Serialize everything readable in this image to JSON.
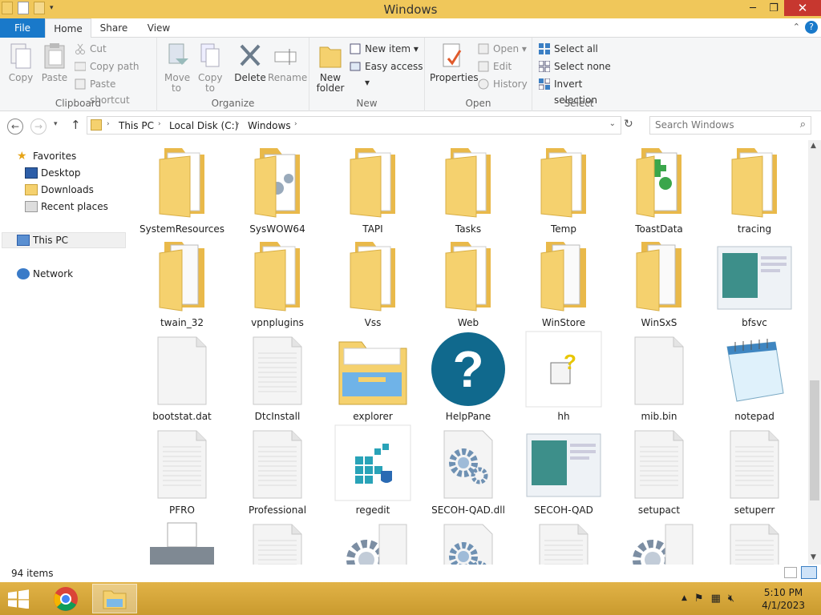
{
  "window": {
    "title": "Windows",
    "minimize": "─",
    "restore": "❐",
    "close": "✕"
  },
  "ribbon_tabs": {
    "file": "File",
    "home": "Home",
    "share": "Share",
    "view": "View",
    "help": "?",
    "collapse": "⌃"
  },
  "clipboard": {
    "copy": "Copy",
    "paste": "Paste",
    "cut": "Cut",
    "copy_path": "Copy path",
    "paste_shortcut": "Paste shortcut",
    "label": "Clipboard"
  },
  "organize": {
    "move_to": "Move to",
    "copy_to": "Copy to",
    "delete": "Delete",
    "rename": "Rename",
    "label": "Organize"
  },
  "new": {
    "new_folder": "New folder",
    "new_item": "New item ▾",
    "easy_access": "Easy access ▾",
    "label": "New"
  },
  "open": {
    "properties": "Properties",
    "open": "Open ▾",
    "edit": "Edit",
    "history": "History",
    "label": "Open"
  },
  "select": {
    "select_all": "Select all",
    "select_none": "Select none",
    "invert": "Invert selection",
    "label": "Select"
  },
  "address": {
    "crumbs": [
      "This PC",
      "Local Disk (C:)",
      "Windows"
    ],
    "search_placeholder": "Search Windows"
  },
  "nav": {
    "favorites": "Favorites",
    "desktop": "Desktop",
    "downloads": "Downloads",
    "recent": "Recent places",
    "this_pc": "This PC",
    "network": "Network"
  },
  "files": [
    {
      "name": "SystemResources",
      "icon": "folder"
    },
    {
      "name": "SysWOW64",
      "icon": "folder-docs"
    },
    {
      "name": "TAPI",
      "icon": "folder"
    },
    {
      "name": "Tasks",
      "icon": "folder"
    },
    {
      "name": "Temp",
      "icon": "folder"
    },
    {
      "name": "ToastData",
      "icon": "folder-green"
    },
    {
      "name": "tracing",
      "icon": "folder"
    },
    {
      "name": "twain_32",
      "icon": "folder-doc"
    },
    {
      "name": "vpnplugins",
      "icon": "folder"
    },
    {
      "name": "Vss",
      "icon": "folder"
    },
    {
      "name": "Web",
      "icon": "folder"
    },
    {
      "name": "WinStore",
      "icon": "folder-doc"
    },
    {
      "name": "WinSxS",
      "icon": "folder-doc"
    },
    {
      "name": "bfsvc",
      "icon": "app-window"
    },
    {
      "name": "bootstat.dat",
      "icon": "file"
    },
    {
      "name": "DtcInstall",
      "icon": "file-lines"
    },
    {
      "name": "explorer",
      "icon": "explorer"
    },
    {
      "name": "HelpPane",
      "icon": "help"
    },
    {
      "name": "hh",
      "icon": "hh"
    },
    {
      "name": "mib.bin",
      "icon": "file"
    },
    {
      "name": "notepad",
      "icon": "notepad"
    },
    {
      "name": "PFRO",
      "icon": "file-lines"
    },
    {
      "name": "Professional",
      "icon": "file-lines"
    },
    {
      "name": "regedit",
      "icon": "regedit"
    },
    {
      "name": "SECOH-QAD.dll",
      "icon": "gear-file"
    },
    {
      "name": "SECOH-QAD",
      "icon": "app-window"
    },
    {
      "name": "setupact",
      "icon": "file-lines"
    },
    {
      "name": "setuperr",
      "icon": "file-lines"
    },
    {
      "name": "",
      "icon": "printer"
    },
    {
      "name": "",
      "icon": "file-lines"
    },
    {
      "name": "",
      "icon": "gear"
    },
    {
      "name": "",
      "icon": "gear-file"
    },
    {
      "name": "",
      "icon": "file-lines"
    },
    {
      "name": "",
      "icon": "gear"
    },
    {
      "name": "",
      "icon": "file-lines"
    }
  ],
  "status": {
    "items": "94 items"
  },
  "taskbar": {
    "time": "5:10 PM",
    "date": "4/1/2023"
  },
  "colors": {
    "titlebar": "#f0c75a",
    "accent": "#1979ca",
    "taskbar": "#d9a531",
    "folder": "#f5d16e"
  }
}
